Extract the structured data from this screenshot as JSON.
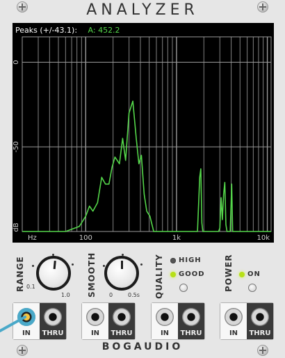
{
  "module": {
    "title": "ANALYZER",
    "brand": "BOGAUDIO"
  },
  "display": {
    "peaks_label": "Peaks (+/-43.1):",
    "peaks_value": "A:  452.2",
    "y_ticks": [
      "0",
      "-50",
      "dB"
    ],
    "x_ticks": [
      "Hz",
      "100",
      "1k",
      "10k"
    ],
    "trace_color": "#54d64a",
    "grid_color": "#9a9a9a",
    "spectrum": {
      "x_axis": "log10 frequency",
      "x_range": [
        20,
        11000
      ],
      "y_range": [
        -100,
        15
      ],
      "points": [
        [
          20,
          -100
        ],
        [
          60,
          -100
        ],
        [
          85,
          -97
        ],
        [
          100,
          -91
        ],
        [
          110,
          -85
        ],
        [
          120,
          -88
        ],
        [
          135,
          -83
        ],
        [
          150,
          -68
        ],
        [
          165,
          -72
        ],
        [
          180,
          -72
        ],
        [
          195,
          -62
        ],
        [
          210,
          -56
        ],
        [
          235,
          -60
        ],
        [
          255,
          -45
        ],
        [
          275,
          -58
        ],
        [
          300,
          -30
        ],
        [
          330,
          -23
        ],
        [
          360,
          -45
        ],
        [
          385,
          -60
        ],
        [
          410,
          -55
        ],
        [
          440,
          -78
        ],
        [
          470,
          -88
        ],
        [
          510,
          -91
        ],
        [
          560,
          -100
        ],
        [
          700,
          -100
        ],
        [
          1500,
          -100
        ],
        [
          1700,
          -100
        ],
        [
          1800,
          -68
        ],
        [
          1850,
          -63
        ],
        [
          1900,
          -95
        ],
        [
          1950,
          -100
        ],
        [
          2900,
          -100
        ],
        [
          3000,
          -98
        ],
        [
          3100,
          -80
        ],
        [
          3200,
          -93
        ],
        [
          3300,
          -78
        ],
        [
          3400,
          -71
        ],
        [
          3500,
          -96
        ],
        [
          3600,
          -100
        ],
        [
          3900,
          -100
        ],
        [
          4050,
          -72
        ],
        [
          4150,
          -100
        ],
        [
          11000,
          -100
        ]
      ]
    }
  },
  "controls": {
    "range": {
      "label": "RANGE",
      "min_label": "0.1",
      "max_label": "1.0",
      "value_fraction": 0.52
    },
    "smooth": {
      "label": "SMOOTH",
      "min_label": "0",
      "max_label": "0.5s",
      "value_fraction": 0.5
    },
    "quality": {
      "label": "QUALITY",
      "options": [
        "HIGH",
        "GOOD"
      ],
      "selected": "GOOD"
    },
    "power": {
      "label": "POWER",
      "option": "ON",
      "state": "on"
    }
  },
  "channels": [
    {
      "in_label": "IN",
      "thru_label": "THRU",
      "connected": true,
      "cable_color": "#4aa9c9"
    },
    {
      "in_label": "IN",
      "thru_label": "THRU",
      "connected": false
    },
    {
      "in_label": "IN",
      "thru_label": "THRU",
      "connected": false
    },
    {
      "in_label": "IN",
      "thru_label": "THRU",
      "connected": false
    }
  ]
}
